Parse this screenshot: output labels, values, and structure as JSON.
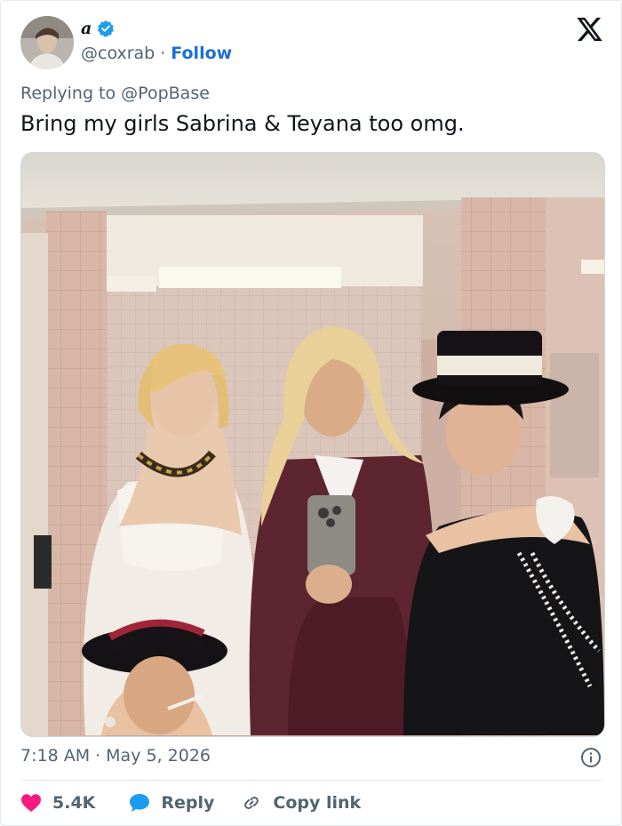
{
  "author": {
    "name": "a",
    "handle": "@coxrab",
    "separator": "·",
    "follow_label": "Follow",
    "verified": true
  },
  "replying": {
    "prefix": "Replying to",
    "target": "@PopBase"
  },
  "tweet": {
    "text": "Bring my girls Sabrina & Teyana too omg."
  },
  "meta": {
    "time": "7:18 AM",
    "separator": "·",
    "date": "May 5, 2026"
  },
  "actions": {
    "likes_count": "5.4K",
    "reply_label": "Reply",
    "copy_label": "Copy link"
  },
  "colors": {
    "accent": "#1d6fd4",
    "like": "#f91880",
    "reply_icon": "#1d9bf0",
    "muted": "#536471",
    "text": "#0f1419"
  },
  "icons": [
    "verified-badge-icon",
    "x-logo-icon",
    "info-icon",
    "heart-icon",
    "reply-bubble-icon",
    "link-icon"
  ]
}
